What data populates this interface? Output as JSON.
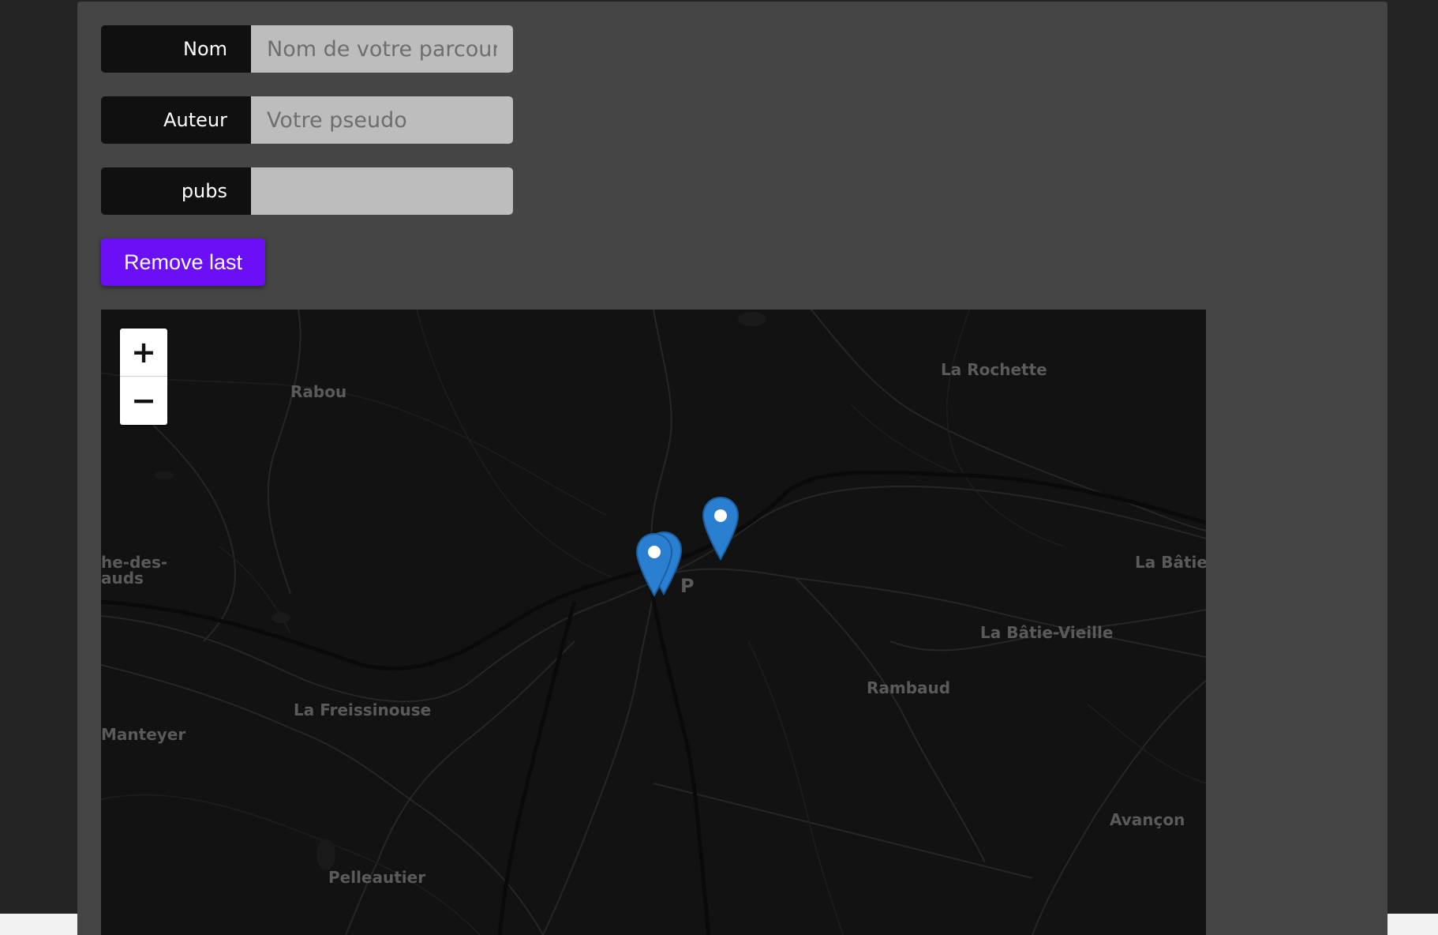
{
  "form": {
    "name_label": "Nom",
    "name_placeholder": "Nom de votre parcours",
    "name_value": "",
    "author_label": "Auteur",
    "author_placeholder": "Votre pseudo",
    "author_value": "",
    "pubs_label": "pubs",
    "pubs_value": "",
    "remove_label": "Remove last"
  },
  "map": {
    "zoom_in": "+",
    "zoom_out": "−",
    "places": {
      "rochette": "La Rochette",
      "rabou": "Rabou",
      "roche": "he-des-\nauds",
      "batie_neuve": "La Bâtie-",
      "batie_vieille": "La Bâtie-Vieille",
      "rambaud": "Rambaud",
      "freissinouse": "La Freissinouse",
      "manteyer": "Manteyer",
      "avancon": "Avançon",
      "pelleautier": "Pelleautier",
      "gap": "P"
    },
    "marker_icon": "map-marker-icon",
    "marker_color": "#2a7fd0"
  },
  "colors": {
    "accent": "#6a0ff7",
    "panel": "#454545",
    "map_bg": "#121212"
  }
}
